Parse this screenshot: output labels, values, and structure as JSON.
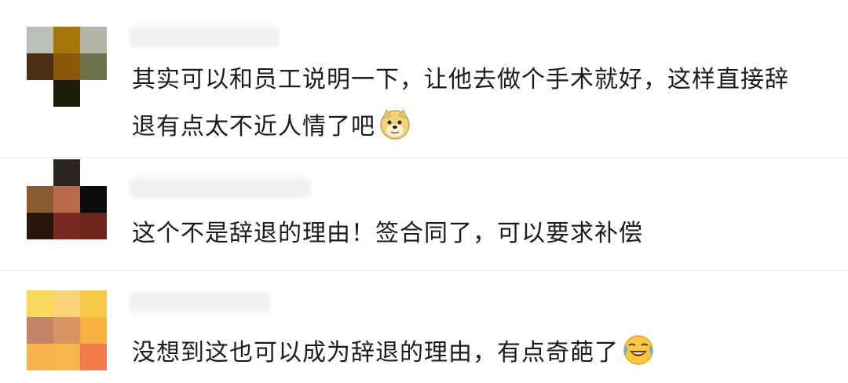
{
  "comments": [
    {
      "avatar_colors": [
        "#b9c0b9",
        "#a6760b",
        "#b2b6a6",
        "#4a2f12",
        "#8a5a08",
        "#6f7249",
        "#ffffff",
        "#1a1e08",
        "#ffffff"
      ],
      "text": "其实可以和员工说明一下，让他去做个手术就好，这样直接辞退有点太不近人情了吧",
      "emoji": "doge-emoji"
    },
    {
      "avatar_colors": [
        "#ffffff",
        "#2b2420",
        "#ffffff",
        "#8c5a30",
        "#b96a48",
        "#0e0b0c",
        "#2a160f",
        "#7a2a20",
        "#6e241a"
      ],
      "text": "这个不是辞退的理由！签合同了，可以要求补偿"
    },
    {
      "avatar_colors": [
        "#fbd95c",
        "#fbd277",
        "#f8c94b",
        "#c48468",
        "#d89462",
        "#f6b140",
        "#f9b34e",
        "#f5b74a",
        "#f27b4c"
      ],
      "text": "没想到这也可以成为辞退的理由，有点奇葩了",
      "emoji": "laugh-cry-emoji"
    }
  ]
}
